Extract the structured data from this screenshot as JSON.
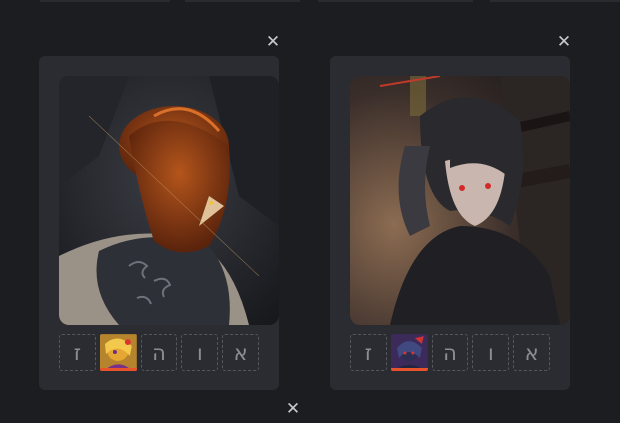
{
  "colors": {
    "accent": "#e8532b",
    "background": "#1c1d21",
    "card": "#2a2c31"
  },
  "close_label": "✕",
  "cards": [
    {
      "character": "orange-hair-character",
      "slots": [
        {
          "label": "א",
          "filled": false
        },
        {
          "label": "ו",
          "filled": false
        },
        {
          "label": "ה",
          "filled": false
        },
        {
          "label": "",
          "filled": true
        },
        {
          "label": "ז",
          "filled": false
        }
      ]
    },
    {
      "character": "dark-hair-character",
      "slots": [
        {
          "label": "א",
          "filled": false
        },
        {
          "label": "ו",
          "filled": false
        },
        {
          "label": "ה",
          "filled": false
        },
        {
          "label": "",
          "filled": true
        },
        {
          "label": "ז",
          "filled": false
        }
      ]
    }
  ]
}
